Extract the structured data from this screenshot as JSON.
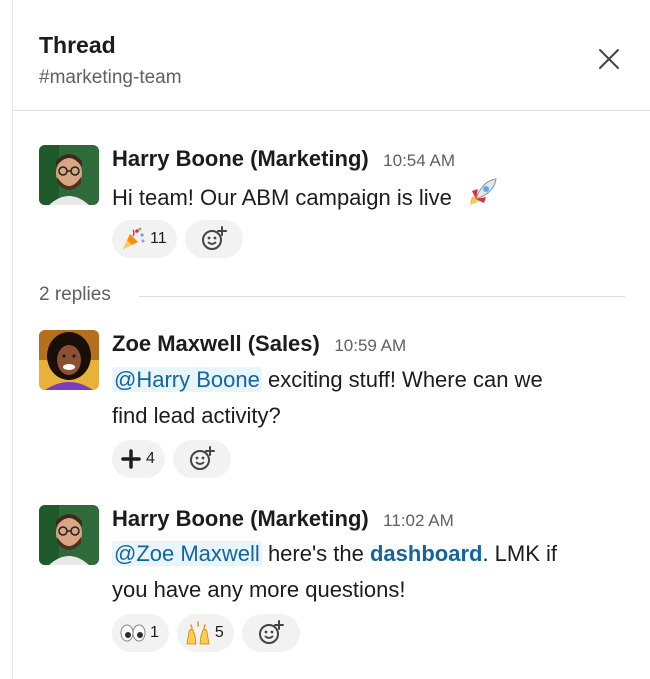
{
  "header": {
    "title": "Thread",
    "channel": "#marketing-team"
  },
  "messages": [
    {
      "author": "Harry Boone (Marketing)",
      "time": "10:54 AM",
      "text": "Hi team! Our ABM campaign is live",
      "reactions": [
        {
          "icon": "party-popper-icon",
          "count": "11"
        }
      ]
    },
    {
      "author": "Zoe Maxwell (Sales)",
      "time": "10:59 AM",
      "mention": "@Harry Boone",
      "text_line1": " exciting stuff! Where can we",
      "text_line2": "find lead activity?",
      "reactions": [
        {
          "icon": "plus-icon",
          "count": "4"
        }
      ]
    },
    {
      "author": "Harry Boone (Marketing)",
      "time": "11:02 AM",
      "mention": "@Zoe Maxwell",
      "text_before_link": " here's the ",
      "link": "dashboard",
      "text_after_link": ". LMK if",
      "text_line2": "you have any more questions!",
      "reactions": [
        {
          "icon": "eyes-icon",
          "count": "1"
        },
        {
          "icon": "raised-hands-icon",
          "count": "5"
        }
      ]
    }
  ],
  "replies_label": "2 replies",
  "colors": {
    "link": "#1264a3",
    "mention_bg": "#e8f5fa",
    "muted": "#616061"
  }
}
